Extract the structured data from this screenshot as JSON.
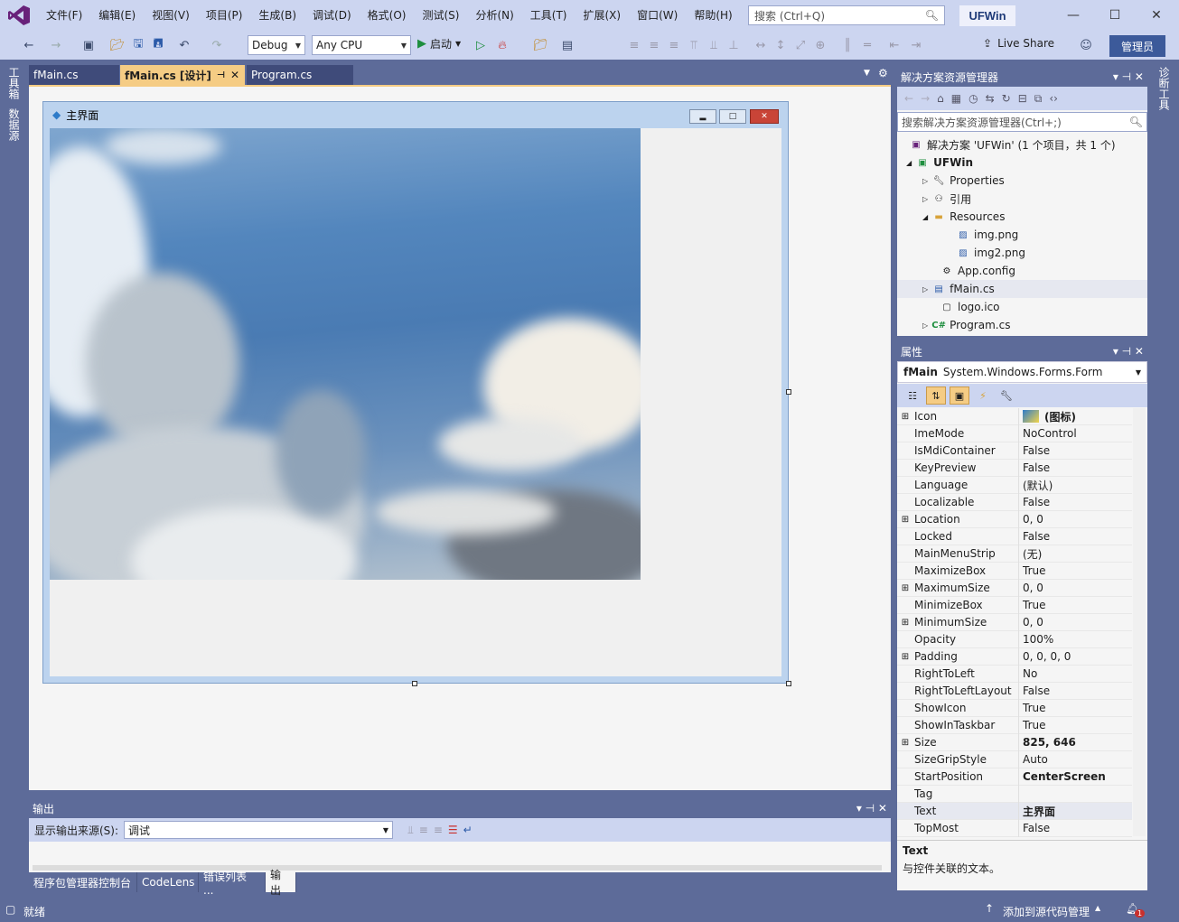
{
  "menu": [
    "文件(F)",
    "编辑(E)",
    "视图(V)",
    "项目(P)",
    "生成(B)",
    "调试(D)",
    "格式(O)",
    "测试(S)",
    "分析(N)",
    "工具(T)",
    "扩展(X)",
    "窗口(W)",
    "帮助(H)"
  ],
  "search": {
    "placeholder": "搜索 (Ctrl+Q)"
  },
  "solution_name": "UFWin",
  "toolbar": {
    "config": "Debug",
    "platform": "Any CPU",
    "start": "启动",
    "liveshare": "Live Share",
    "admin": "管理员"
  },
  "left_strip": [
    "工具箱",
    "数据源"
  ],
  "right_strip": [
    "诊断工具"
  ],
  "doc_tabs": [
    {
      "label": "fMain.cs"
    },
    {
      "label": "fMain.cs [设计]"
    },
    {
      "label": "Program.cs"
    }
  ],
  "form": {
    "title": "主界面"
  },
  "output": {
    "title": "输出",
    "source_label": "显示输出来源(S):",
    "source_value": "调试"
  },
  "bottom_tabs": [
    "程序包管理器控制台",
    "CodeLens",
    "错误列表 ...",
    "输出"
  ],
  "solution_explorer": {
    "title": "解决方案资源管理器",
    "search": "搜索解决方案资源管理器(Ctrl+;)",
    "items": [
      {
        "label": "解决方案 'UFWin' (1 个项目，共 1 个)",
        "icon": "solution-icon"
      },
      {
        "label": "UFWin",
        "icon": "csproj-icon"
      },
      {
        "label": "Properties",
        "icon": "wrench-icon"
      },
      {
        "label": "引用",
        "icon": "references-icon"
      },
      {
        "label": "Resources",
        "icon": "folder-icon"
      },
      {
        "label": "img.png",
        "icon": "image-icon"
      },
      {
        "label": "img2.png",
        "icon": "image-icon"
      },
      {
        "label": "App.config",
        "icon": "config-icon"
      },
      {
        "label": "fMain.cs",
        "icon": "form-icon"
      },
      {
        "label": "logo.ico",
        "icon": "ico-icon"
      },
      {
        "label": "Program.cs",
        "icon": "csharp-icon"
      }
    ]
  },
  "properties": {
    "title": "属性",
    "object_name": "fMain",
    "object_type": "System.Windows.Forms.Form",
    "rows": [
      {
        "name": "Icon",
        "value": "(图标)",
        "bold": true
      },
      {
        "name": "ImeMode",
        "value": "NoControl"
      },
      {
        "name": "IsMdiContainer",
        "value": "False"
      },
      {
        "name": "KeyPreview",
        "value": "False"
      },
      {
        "name": "Language",
        "value": "(默认)"
      },
      {
        "name": "Localizable",
        "value": "False"
      },
      {
        "name": "Location",
        "value": "0, 0"
      },
      {
        "name": "Locked",
        "value": "False"
      },
      {
        "name": "MainMenuStrip",
        "value": "(无)"
      },
      {
        "name": "MaximizeBox",
        "value": "True"
      },
      {
        "name": "MaximumSize",
        "value": "0, 0"
      },
      {
        "name": "MinimizeBox",
        "value": "True"
      },
      {
        "name": "MinimumSize",
        "value": "0, 0"
      },
      {
        "name": "Opacity",
        "value": "100%"
      },
      {
        "name": "Padding",
        "value": "0, 0, 0, 0"
      },
      {
        "name": "RightToLeft",
        "value": "No"
      },
      {
        "name": "RightToLeftLayout",
        "value": "False"
      },
      {
        "name": "ShowIcon",
        "value": "True"
      },
      {
        "name": "ShowInTaskbar",
        "value": "True"
      },
      {
        "name": "Size",
        "value": "825, 646",
        "bold": true
      },
      {
        "name": "SizeGripStyle",
        "value": "Auto"
      },
      {
        "name": "StartPosition",
        "value": "CenterScreen",
        "bold": true
      },
      {
        "name": "Tag",
        "value": ""
      },
      {
        "name": "Text",
        "value": "主界面",
        "bold": true
      },
      {
        "name": "TopMost",
        "value": "False"
      }
    ],
    "desc_title": "Text",
    "desc_text": "与控件关联的文本。"
  },
  "status": {
    "ready": "就绪",
    "source_control": "添加到源代码管理",
    "notifications": "1"
  }
}
